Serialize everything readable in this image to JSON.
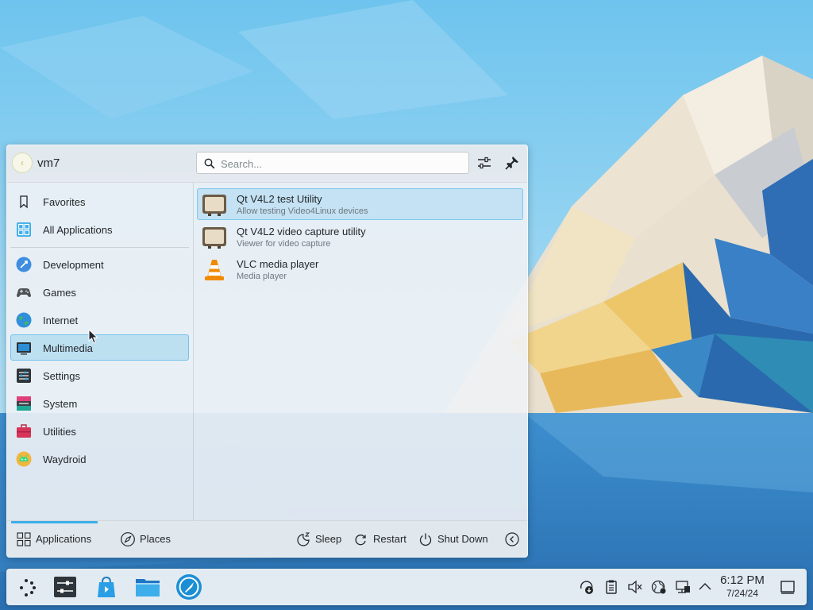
{
  "launcher": {
    "user": {
      "name": "vm7",
      "avatar_icon": "user-avatar-icon"
    },
    "search": {
      "placeholder": "Search..."
    },
    "header_buttons": [
      {
        "icon": "configure-sliders-icon"
      },
      {
        "icon": "pin-icon"
      }
    ],
    "categories": [
      {
        "label": "Favorites",
        "icon": "bookmark-icon"
      },
      {
        "label": "All Applications",
        "icon": "grid-icon"
      },
      {
        "label": "Development",
        "icon": "development-icon"
      },
      {
        "label": "Games",
        "icon": "gamepad-icon"
      },
      {
        "label": "Internet",
        "icon": "globe-icon"
      },
      {
        "label": "Multimedia",
        "icon": "multimedia-icon",
        "selected": true
      },
      {
        "label": "Settings",
        "icon": "settings-icon"
      },
      {
        "label": "System",
        "icon": "system-icon"
      },
      {
        "label": "Utilities",
        "icon": "toolbox-icon"
      },
      {
        "label": "Waydroid",
        "icon": "android-icon"
      }
    ],
    "apps": [
      {
        "name": "Qt V4L2 test Utility",
        "description": "Allow testing Video4Linux devices",
        "icon": "tv-icon",
        "highlighted": true
      },
      {
        "name": "Qt V4L2 video capture utility",
        "description": "Viewer for video capture",
        "icon": "tv-icon"
      },
      {
        "name": "VLC media player",
        "description": "Media player",
        "icon": "vlc-cone-icon"
      }
    ],
    "footer": {
      "tabs": [
        {
          "label": "Applications",
          "icon": "applications-grid-icon",
          "active": true
        },
        {
          "label": "Places",
          "icon": "compass-icon"
        }
      ],
      "power": [
        {
          "label": "Sleep",
          "icon": "sleep-icon"
        },
        {
          "label": "Restart",
          "icon": "restart-icon"
        },
        {
          "label": "Shut Down",
          "icon": "power-icon"
        }
      ],
      "more_icon": "chevron-left-circle-icon"
    }
  },
  "taskbar": {
    "launcher_icon": "kde-launcher-icon",
    "tasks": [
      {
        "icon": "system-settings-icon"
      },
      {
        "icon": "discover-store-icon"
      },
      {
        "icon": "folder-icon"
      },
      {
        "icon": "browser-icon"
      }
    ],
    "tray": [
      {
        "icon": "updates-icon"
      },
      {
        "icon": "clipboard-icon"
      },
      {
        "icon": "volume-muted-icon"
      },
      {
        "icon": "network-globe-icon"
      },
      {
        "icon": "display-network-icon"
      },
      {
        "icon": "chevron-up-icon"
      }
    ],
    "clock": {
      "time": "6:12 PM",
      "date": "7/24/24"
    },
    "show_desktop_icon": "show-desktop-icon"
  },
  "colors": {
    "accent": "#3daee9",
    "panel_bg": "#eff2f5",
    "text": "#232629",
    "subtext": "#6e777e"
  }
}
